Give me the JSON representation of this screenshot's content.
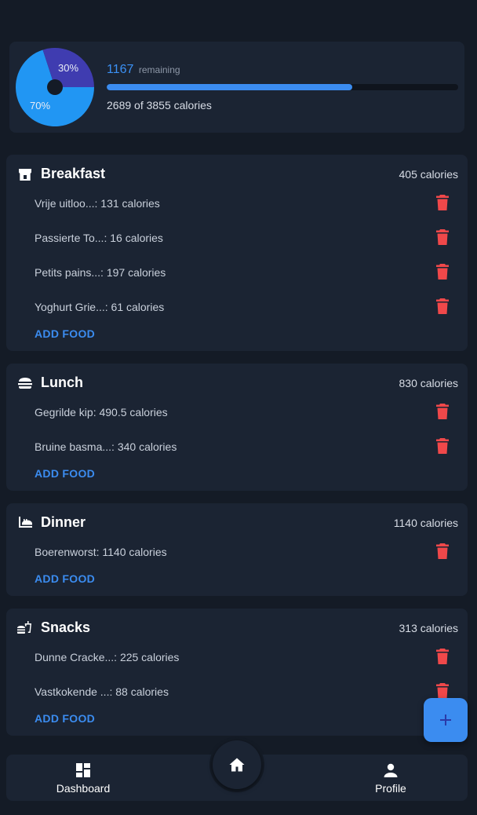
{
  "summary": {
    "remaining_value": "1167",
    "remaining_label": "remaining",
    "consumed_text": "2689 of 3855 calories",
    "progress_fraction": 0.6976,
    "pie": {
      "slices": [
        {
          "label": "70%",
          "value": 70,
          "color": "#2196f3"
        },
        {
          "label": "30%",
          "value": 30,
          "color": "#3f3cb0"
        }
      ]
    }
  },
  "meals": [
    {
      "title": "Breakfast",
      "icon": "bakery-icon",
      "calories": "405 calories",
      "foods": [
        "Vrije uitloo...: 131 calories",
        "Passierte To...: 16 calories",
        "Petits pains...: 197 calories",
        "Yoghurt Grie...: 61 calories"
      ],
      "add_label": "ADD FOOD"
    },
    {
      "title": "Lunch",
      "icon": "burger-icon",
      "calories": "830 calories",
      "foods": [
        "Gegrilde kip: 490.5 calories",
        "Bruine basma...: 340 calories"
      ],
      "add_label": "ADD FOOD"
    },
    {
      "title": "Dinner",
      "icon": "dinner-icon",
      "calories": "1140 calories",
      "foods": [
        "Boerenworst: 1140 calories"
      ],
      "add_label": "ADD FOOD"
    },
    {
      "title": "Snacks",
      "icon": "fastfood-icon",
      "calories": "313 calories",
      "foods": [
        "Dunne Cracke...: 225 calories",
        "Vastkokende ...: 88 calories"
      ],
      "add_label": "ADD FOOD"
    }
  ],
  "nav": {
    "dashboard_label": "Dashboard",
    "profile_label": "Profile"
  },
  "colors": {
    "accent": "#3b8cf0",
    "delete": "#f0484a",
    "card": "#1b2433",
    "background": "#141b26"
  }
}
